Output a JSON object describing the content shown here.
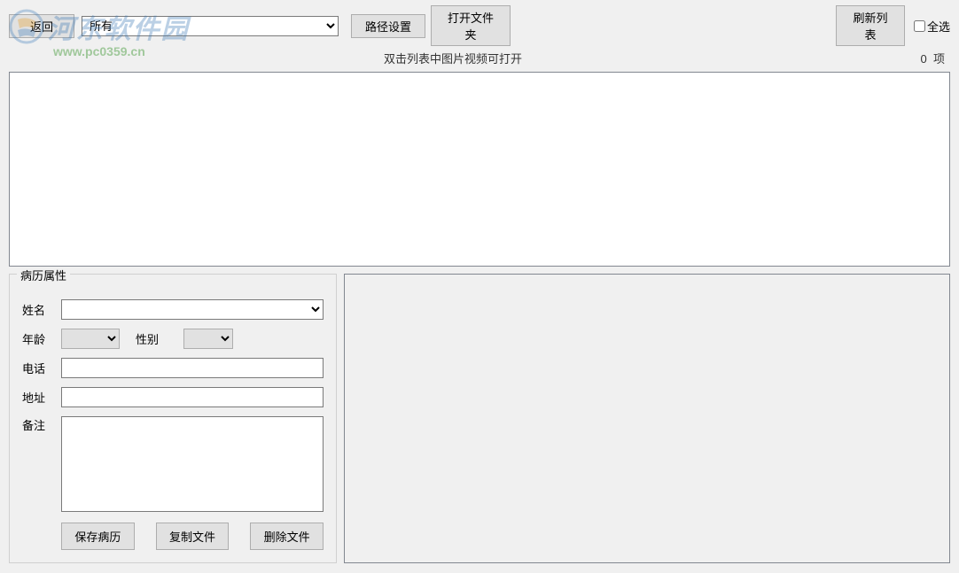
{
  "watermark": {
    "text": "河东软件园",
    "url": "www.pc0359.cn"
  },
  "toolbar": {
    "back_label": "返回",
    "main_combo_value": "所有",
    "path_settings_label": "路径设置",
    "open_folder_label": "打开文件夹",
    "refresh_label": "刷新列表",
    "select_all_label": "全选"
  },
  "info": {
    "hint": "双击列表中图片视频可打开",
    "count": "0",
    "count_unit": "项"
  },
  "record": {
    "legend": "病历属性",
    "name_label": "姓名",
    "name_value": "",
    "age_label": "年龄",
    "age_value": "",
    "gender_label": "性别",
    "gender_value": "",
    "phone_label": "电话",
    "phone_value": "",
    "address_label": "地址",
    "address_value": "",
    "notes_label": "备注",
    "notes_value": "",
    "save_label": "保存病历",
    "copy_label": "复制文件",
    "delete_label": "删除文件"
  }
}
